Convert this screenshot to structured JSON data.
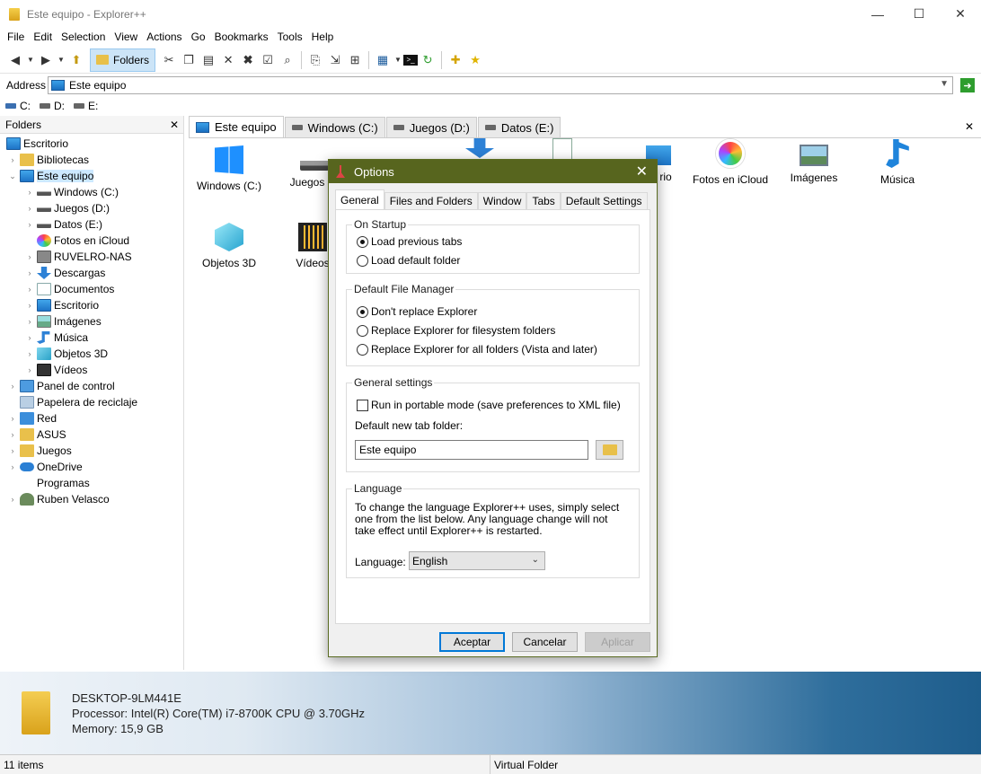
{
  "window": {
    "title": "Este equipo - Explorer++",
    "min_glyph": "—",
    "max_glyph": "☐",
    "close_glyph": "✕"
  },
  "menu": [
    "File",
    "Edit",
    "Selection",
    "View",
    "Actions",
    "Go",
    "Bookmarks",
    "Tools",
    "Help"
  ],
  "toolbar": {
    "folders_label": "Folders"
  },
  "address": {
    "label": "Address",
    "value": "Este equipo"
  },
  "drives": [
    "C:",
    "D:",
    "E:"
  ],
  "folders_pane": {
    "header": "Folders",
    "close_glyph": "✕",
    "items": [
      {
        "label": "Escritorio",
        "icon": "desktop-icon"
      },
      {
        "label": "Bibliotecas",
        "icon": "folder-icon"
      },
      {
        "label": "Este equipo",
        "icon": "computer-icon"
      },
      {
        "label": "Windows (C:)",
        "icon": "drive-icon"
      },
      {
        "label": "Juegos (D:)",
        "icon": "drive-icon"
      },
      {
        "label": "Datos (E:)",
        "icon": "drive-icon"
      },
      {
        "label": "Fotos en iCloud",
        "icon": "photos-icon"
      },
      {
        "label": "RUVELRO-NAS",
        "icon": "nas-icon"
      },
      {
        "label": "Descargas",
        "icon": "download-icon"
      },
      {
        "label": "Documentos",
        "icon": "documents-icon"
      },
      {
        "label": "Escritorio",
        "icon": "desktop-icon"
      },
      {
        "label": "Imágenes",
        "icon": "images-icon"
      },
      {
        "label": "Música",
        "icon": "music-icon"
      },
      {
        "label": "Objetos 3D",
        "icon": "objects-3d-icon"
      },
      {
        "label": "Vídeos",
        "icon": "videos-icon"
      },
      {
        "label": "Panel de control",
        "icon": "control-panel-icon"
      },
      {
        "label": "Papelera de reciclaje",
        "icon": "recycle-bin-icon"
      },
      {
        "label": "Red",
        "icon": "network-icon"
      },
      {
        "label": "ASUS",
        "icon": "folder-icon"
      },
      {
        "label": "Juegos",
        "icon": "folder-icon"
      },
      {
        "label": "OneDrive",
        "icon": "onedrive-icon"
      },
      {
        "label": "Programas",
        "icon": "none"
      },
      {
        "label": "Ruben Velasco",
        "icon": "user-icon"
      }
    ]
  },
  "tabs": [
    {
      "label": "Este equipo",
      "icon": "computer-icon"
    },
    {
      "label": "Windows (C:)",
      "icon": "drive-icon"
    },
    {
      "label": "Juegos (D:)",
      "icon": "drive-icon"
    },
    {
      "label": "Datos (E:)",
      "icon": "drive-icon"
    }
  ],
  "files": [
    {
      "label": "Windows (C:)",
      "icon": "windows-drive-icon"
    },
    {
      "label": "Juegos (D",
      "icon": "drive-icon"
    },
    {
      "label": "Fotos en iCloud",
      "icon": "photos-icon"
    },
    {
      "label": "Imágenes",
      "icon": "images-icon"
    },
    {
      "label": "Música",
      "icon": "music-icon"
    },
    {
      "label": "Objetos 3D",
      "icon": "objects-3d-icon"
    },
    {
      "label": "Vídeos",
      "icon": "videos-icon"
    },
    {
      "label": "rio",
      "icon": "desktop-icon"
    }
  ],
  "info": {
    "computer": "DESKTOP-9LM441E",
    "processor": "Processor: Intel(R) Core(TM) i7-8700K CPU @ 3.70GHz",
    "memory": "Memory: 15,9 GB"
  },
  "status": {
    "items": "11 items",
    "location": "Virtual Folder"
  },
  "dialog": {
    "title": "Options",
    "close_glyph": "✕",
    "tabs": [
      "General",
      "Files and Folders",
      "Window",
      "Tabs",
      "Default Settings"
    ],
    "startup": {
      "title": "On Startup",
      "option1": "Load previous tabs",
      "option2": "Load default folder",
      "selected": 1
    },
    "file_manager": {
      "title": "Default File Manager",
      "option1": "Don't replace Explorer",
      "option2": "Replace Explorer for filesystem folders",
      "option3": "Replace Explorer for all folders (Vista and later)",
      "selected": 1
    },
    "general": {
      "title": "General settings",
      "portable_label": "Run in portable mode (save preferences to XML file)",
      "portable_checked": false,
      "new_tab_label": "Default new tab folder:",
      "new_tab_value": "Este equipo"
    },
    "language": {
      "title": "Language",
      "description": "To change the language Explorer++ uses, simply select one from the list below. Any language change will not take effect until Explorer++ is restarted.",
      "label": "Language:",
      "selected": "English"
    },
    "buttons": {
      "ok": "Aceptar",
      "cancel": "Cancelar",
      "apply": "Aplicar"
    }
  },
  "colors": {
    "dialog_title_bar": "#57651e",
    "selection": "#cce8ff",
    "accent": "#0078d7"
  }
}
